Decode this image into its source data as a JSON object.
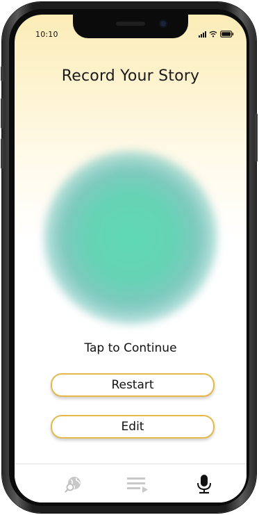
{
  "status_bar": {
    "time": "10:10",
    "icons": [
      "signal-icon",
      "wifi-icon",
      "battery-icon"
    ]
  },
  "header": {
    "title": "Record Your Story"
  },
  "recorder": {
    "orb_color": "#5fd9b5",
    "prompt": "Tap to Continue"
  },
  "actions": {
    "restart_label": "Restart",
    "edit_label": "Edit",
    "border_color": "#e6b84a"
  },
  "tab_bar": {
    "items": [
      {
        "icon": "globe-search-icon",
        "active": false
      },
      {
        "icon": "playlist-icon",
        "active": false
      },
      {
        "icon": "microphone-icon",
        "active": true
      }
    ]
  }
}
